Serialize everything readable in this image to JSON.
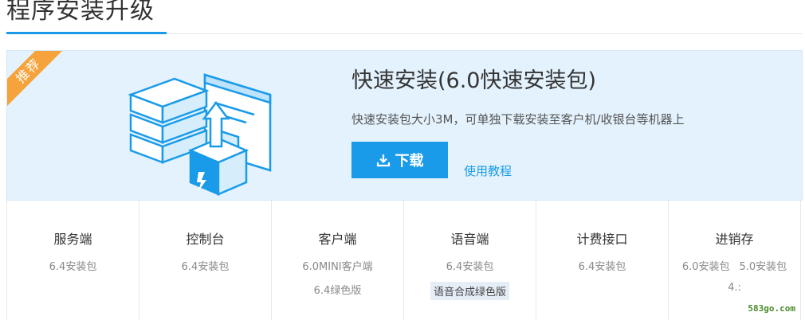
{
  "page": {
    "title": "程序安装升级"
  },
  "hero": {
    "badge": "推荐",
    "title": "快速安装(6.0快速安装包)",
    "description": "快速安装包大小3M，可单独下载安装至客户机/收银台等机器上",
    "download_label": "下载",
    "tutorial_label": "使用教程"
  },
  "categories": [
    {
      "title": "服务端",
      "line1": "6.4安装包",
      "line2": ""
    },
    {
      "title": "控制台",
      "line1": "6.4安装包",
      "line2": ""
    },
    {
      "title": "客户端",
      "line1": "6.0MINI客户端",
      "line2": "6.4绿色版"
    },
    {
      "title": "语音端",
      "line1": "6.4安装包",
      "line2": "语音合成绿色版"
    },
    {
      "title": "计费接口",
      "line1": "6.4安装包",
      "line2": ""
    },
    {
      "title": "进销存",
      "line1a": "6.0安装包",
      "line1b": "5.0安装包",
      "line2": "4.:"
    }
  ],
  "watermark": "583go.com",
  "colors": {
    "accent": "#1a9bea",
    "badge": "#f6a33c",
    "hero_bg": "#e3f2fd"
  }
}
